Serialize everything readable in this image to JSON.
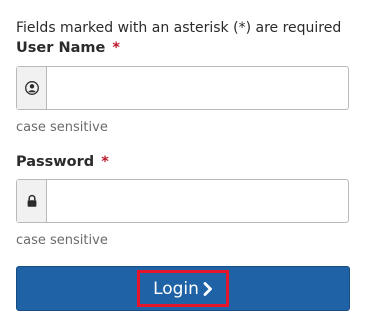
{
  "form": {
    "required_note": "Fields marked with an asterisk (*) are required",
    "username": {
      "label": "User Name",
      "required_marker": "*",
      "value": "",
      "help": "case sensitive",
      "icon": "user-circle-icon"
    },
    "password": {
      "label": "Password",
      "required_marker": "*",
      "value": "",
      "help": "case sensitive",
      "icon": "lock-icon"
    },
    "login_button": {
      "label": "Login",
      "icon": "chevron-right-icon"
    }
  },
  "colors": {
    "button_bg": "#1f63a6",
    "required_asterisk": "#b7172b",
    "highlight_border": "#e5162b"
  }
}
